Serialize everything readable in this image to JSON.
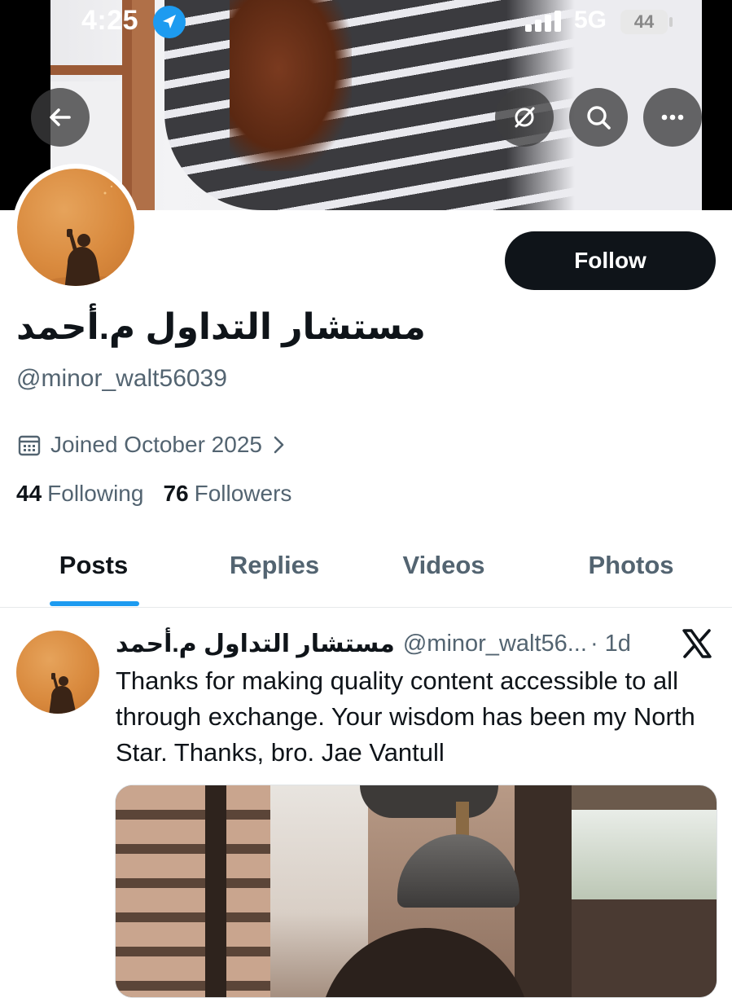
{
  "status_bar": {
    "time": "4:25",
    "network": "5G",
    "battery": "44"
  },
  "banner": {
    "back_button": "back",
    "hide_button": "hide-from-view",
    "search_button": "search",
    "more_button": "more"
  },
  "profile": {
    "display_name": "مستشار التداول م.أحمد",
    "handle": "@minor_walt56039",
    "joined": "Joined October 2025",
    "following_count": "44",
    "following_label": "Following",
    "followers_count": "76",
    "followers_label": "Followers",
    "follow_label": "Follow"
  },
  "tabs": [
    {
      "label": "Posts",
      "active": true
    },
    {
      "label": "Replies",
      "active": false
    },
    {
      "label": "Videos",
      "active": false
    },
    {
      "label": "Photos",
      "active": false
    }
  ],
  "post": {
    "name": "مستشار التداول م.أحمد",
    "handle": "@minor_walt56...",
    "time": "· 1d",
    "text": "Thanks for making quality content accessible to all through exchange. Your wisdom has been my North Star. Thanks, bro. Jae Vantull"
  },
  "colors": {
    "accent": "#1d9bf0",
    "text_primary": "#0f1419",
    "text_secondary": "#536471",
    "follow_bg": "#0f1419"
  },
  "icons": {
    "location": "location-arrow-icon",
    "signal": "signal-bars-icon",
    "back": "arrow-left-icon",
    "hide": "eye-slash-icon",
    "search": "search-icon",
    "more": "ellipsis-icon",
    "calendar": "calendar-icon",
    "chevron": "chevron-right-icon",
    "x_logo": "x-logo-icon"
  }
}
